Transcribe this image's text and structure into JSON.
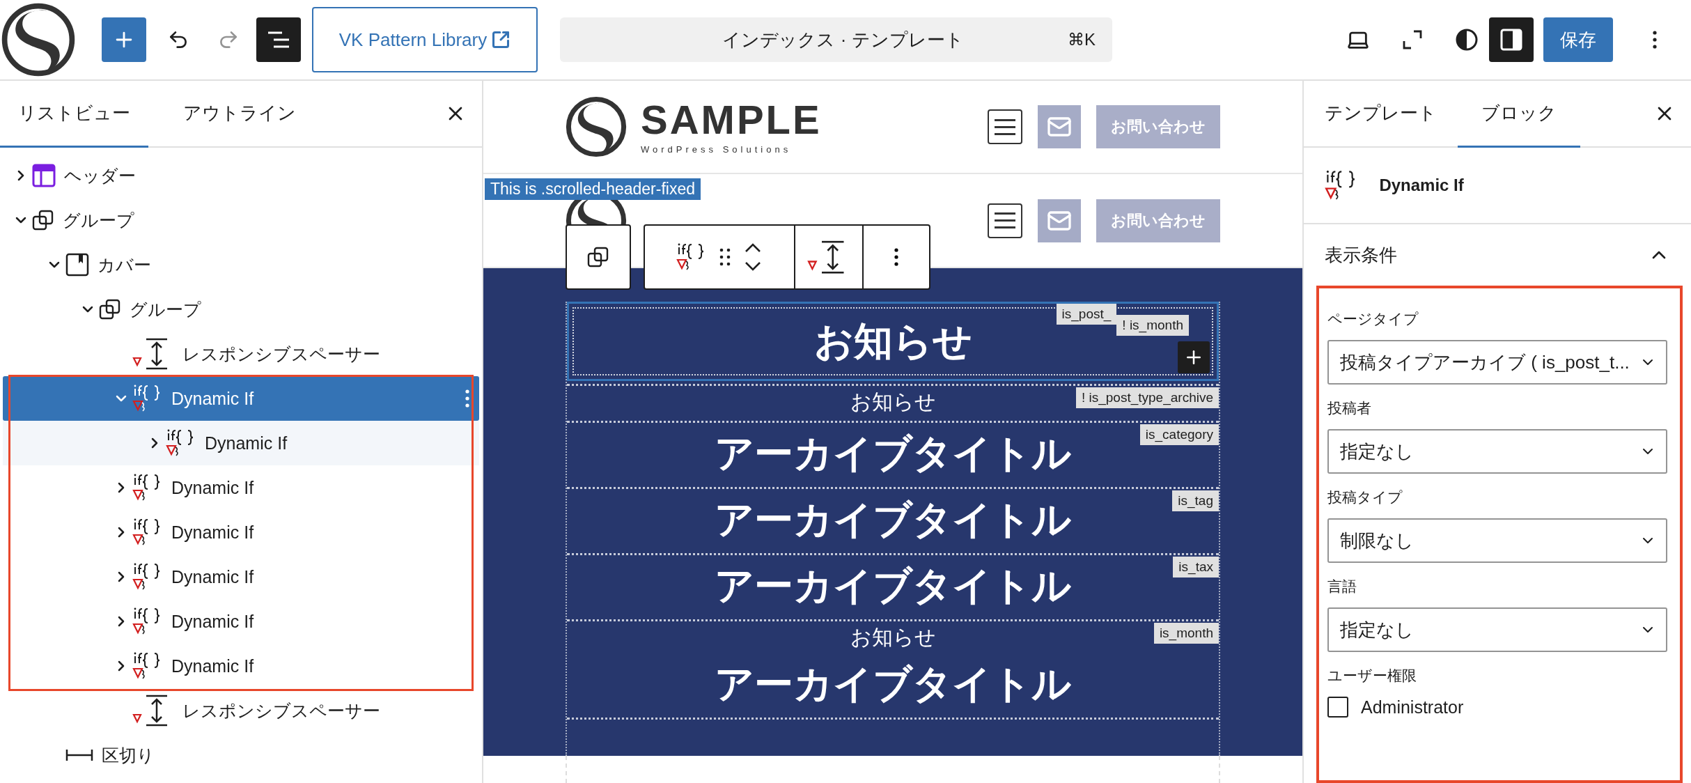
{
  "toolbar": {
    "history": [
      {
        "kind": "undo",
        "disabled": false
      },
      {
        "kind": "redo",
        "disabled": true
      }
    ],
    "list_view": {
      "pressed": true
    },
    "link": {
      "label": "VK Pattern Library"
    },
    "command": {
      "title": "インデックス · テンプレート",
      "shortcut": "⌘K"
    },
    "settings": {
      "pressed": true
    },
    "save": {
      "label": "保存"
    }
  },
  "sidebar": {
    "tabs": [
      {
        "label": "リストビュー",
        "selected": true
      },
      {
        "label": "アウトライン",
        "selected": false
      }
    ],
    "selection_outlined": true,
    "tree": [
      {
        "kind": "header",
        "label": "ヘッダー",
        "expanded": false,
        "selected": false
      },
      {
        "kind": "group",
        "label": "グループ",
        "expanded": true,
        "selected": false,
        "children": [
          {
            "kind": "cover",
            "label": "カバー",
            "expanded": true,
            "selected": false,
            "children": [
              {
                "kind": "group",
                "label": "グループ",
                "expanded": true,
                "selected": false,
                "children": [
                  {
                    "kind": "spacer",
                    "label": "レスポンシブスペーサー",
                    "selected": false
                  },
                  {
                    "kind": "dynamic-if",
                    "label": "Dynamic If",
                    "expanded": true,
                    "selected": true,
                    "children": [
                      {
                        "kind": "dynamic-if",
                        "label": "Dynamic If",
                        "expanded": false,
                        "selected": false
                      }
                    ]
                  },
                  {
                    "kind": "dynamic-if",
                    "label": "Dynamic If",
                    "expanded": false,
                    "selected": false
                  },
                  {
                    "kind": "dynamic-if",
                    "label": "Dynamic If",
                    "expanded": false,
                    "selected": false
                  },
                  {
                    "kind": "dynamic-if",
                    "label": "Dynamic If",
                    "expanded": false,
                    "selected": false
                  },
                  {
                    "kind": "dynamic-if",
                    "label": "Dynamic If",
                    "expanded": false,
                    "selected": false
                  },
                  {
                    "kind": "dynamic-if",
                    "label": "Dynamic If",
                    "expanded": false,
                    "selected": false
                  },
                  {
                    "kind": "spacer",
                    "label": "レスポンシブスペーサー",
                    "selected": false
                  }
                ]
              }
            ]
          },
          {
            "kind": "separator",
            "label": "区切り",
            "selected": false
          }
        ]
      }
    ]
  },
  "canvas": {
    "header": {
      "site_name": "SAMPLE",
      "tagline": "WordPress Solutions",
      "contact": "お問い合わせ"
    },
    "fixed_header": {
      "label": "This is .scrolled-header-fixed",
      "contact": "お問い合わせ"
    },
    "blocks": [
      {
        "selected": true,
        "tags": [
          "is_post_",
          "! is_month"
        ],
        "lines": [
          {
            "kind": "heading",
            "text": "お知らせ"
          }
        ]
      },
      {
        "selected": false,
        "tags": [
          "! is_post_type_archive"
        ],
        "lines": [
          {
            "kind": "subtitle",
            "text": "お知らせ"
          }
        ]
      },
      {
        "selected": false,
        "tags": [
          "is_category"
        ],
        "lines": [
          {
            "kind": "heading",
            "text": "アーカイブタイトル"
          }
        ]
      },
      {
        "selected": false,
        "tags": [
          "is_tag"
        ],
        "lines": [
          {
            "kind": "heading",
            "text": "アーカイブタイトル"
          }
        ]
      },
      {
        "selected": false,
        "tags": [
          "is_tax"
        ],
        "lines": [
          {
            "kind": "heading",
            "text": "アーカイブタイトル"
          }
        ]
      },
      {
        "selected": false,
        "tags": [
          "is_month"
        ],
        "lines": [
          {
            "kind": "subtitle",
            "text": "お知らせ"
          },
          {
            "kind": "heading",
            "text": "アーカイブタイトル"
          }
        ]
      },
      {
        "selected": false
      }
    ]
  },
  "inspector": {
    "tabs": [
      {
        "label": "テンプレート",
        "selected": false
      },
      {
        "label": "ブロック",
        "selected": true
      }
    ],
    "block": {
      "title": "Dynamic If"
    },
    "panel": {
      "title": "表示条件",
      "expanded": true,
      "outlined": true,
      "fields": [
        {
          "kind": "select",
          "label": "ページタイプ",
          "value": "投稿タイプアーカイブ ( is_post_t..."
        },
        {
          "kind": "select",
          "label": "投稿者",
          "value": "指定なし"
        },
        {
          "kind": "select",
          "label": "投稿タイプ",
          "value": "制限なし"
        },
        {
          "kind": "select",
          "label": "言語",
          "value": "指定なし"
        },
        {
          "kind": "checkboxes",
          "label": "ユーザー権限",
          "options": [
            {
              "label": "Administrator",
              "checked": false
            }
          ]
        }
      ]
    }
  }
}
